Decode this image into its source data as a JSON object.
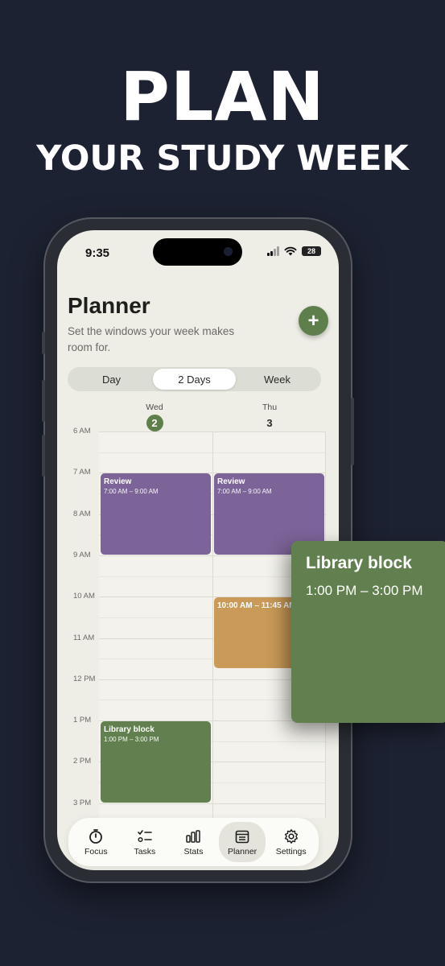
{
  "headline": {
    "line1": "PLAN",
    "line2": "YOUR STUDY WEEK"
  },
  "status_bar": {
    "time": "9:35",
    "battery": "28"
  },
  "header": {
    "title": "Planner",
    "subtitle": "Set the windows your week makes room for.",
    "add_button": "+"
  },
  "view_switcher": {
    "options": [
      "Day",
      "2 Days",
      "Week"
    ],
    "selected": "2 Days"
  },
  "days": [
    {
      "name": "Wed",
      "number": "2",
      "today": true
    },
    {
      "name": "Thu",
      "number": "3",
      "today": false
    }
  ],
  "hours": [
    "6 AM",
    "7 AM",
    "8 AM",
    "9 AM",
    "10 AM",
    "11 AM",
    "12 PM",
    "1 PM",
    "2 PM",
    "3 PM"
  ],
  "events": [
    {
      "day": 0,
      "title": "Review",
      "time": "7:00 AM – 9:00 AM",
      "start": 7,
      "end": 9,
      "color": "#7c6398"
    },
    {
      "day": 1,
      "title": "Review",
      "time": "7:00 AM – 9:00 AM",
      "start": 7,
      "end": 9,
      "color": "#7c6398"
    },
    {
      "day": 1,
      "title": "",
      "time": "10:00 AM – 11:45 AM",
      "start": 10,
      "end": 11.75,
      "color": "#c99a58"
    },
    {
      "day": 0,
      "title": "Library block",
      "time": "1:00 PM – 3:00 PM",
      "start": 13,
      "end": 15,
      "color": "#62804f"
    }
  ],
  "popout": {
    "title": "Library block",
    "time": "1:00 PM – 3:00 PM",
    "color": "#62804f"
  },
  "tabbar": {
    "items": [
      {
        "label": "Focus",
        "icon": "timer-icon"
      },
      {
        "label": "Tasks",
        "icon": "checklist-icon"
      },
      {
        "label": "Stats",
        "icon": "bar-chart-icon"
      },
      {
        "label": "Planner",
        "icon": "calendar-icon"
      },
      {
        "label": "Settings",
        "icon": "gear-icon"
      }
    ],
    "selected": "Planner"
  },
  "colors": {
    "accent": "#5e7f4c",
    "background": "#1d2232",
    "screen": "#eeede6"
  }
}
